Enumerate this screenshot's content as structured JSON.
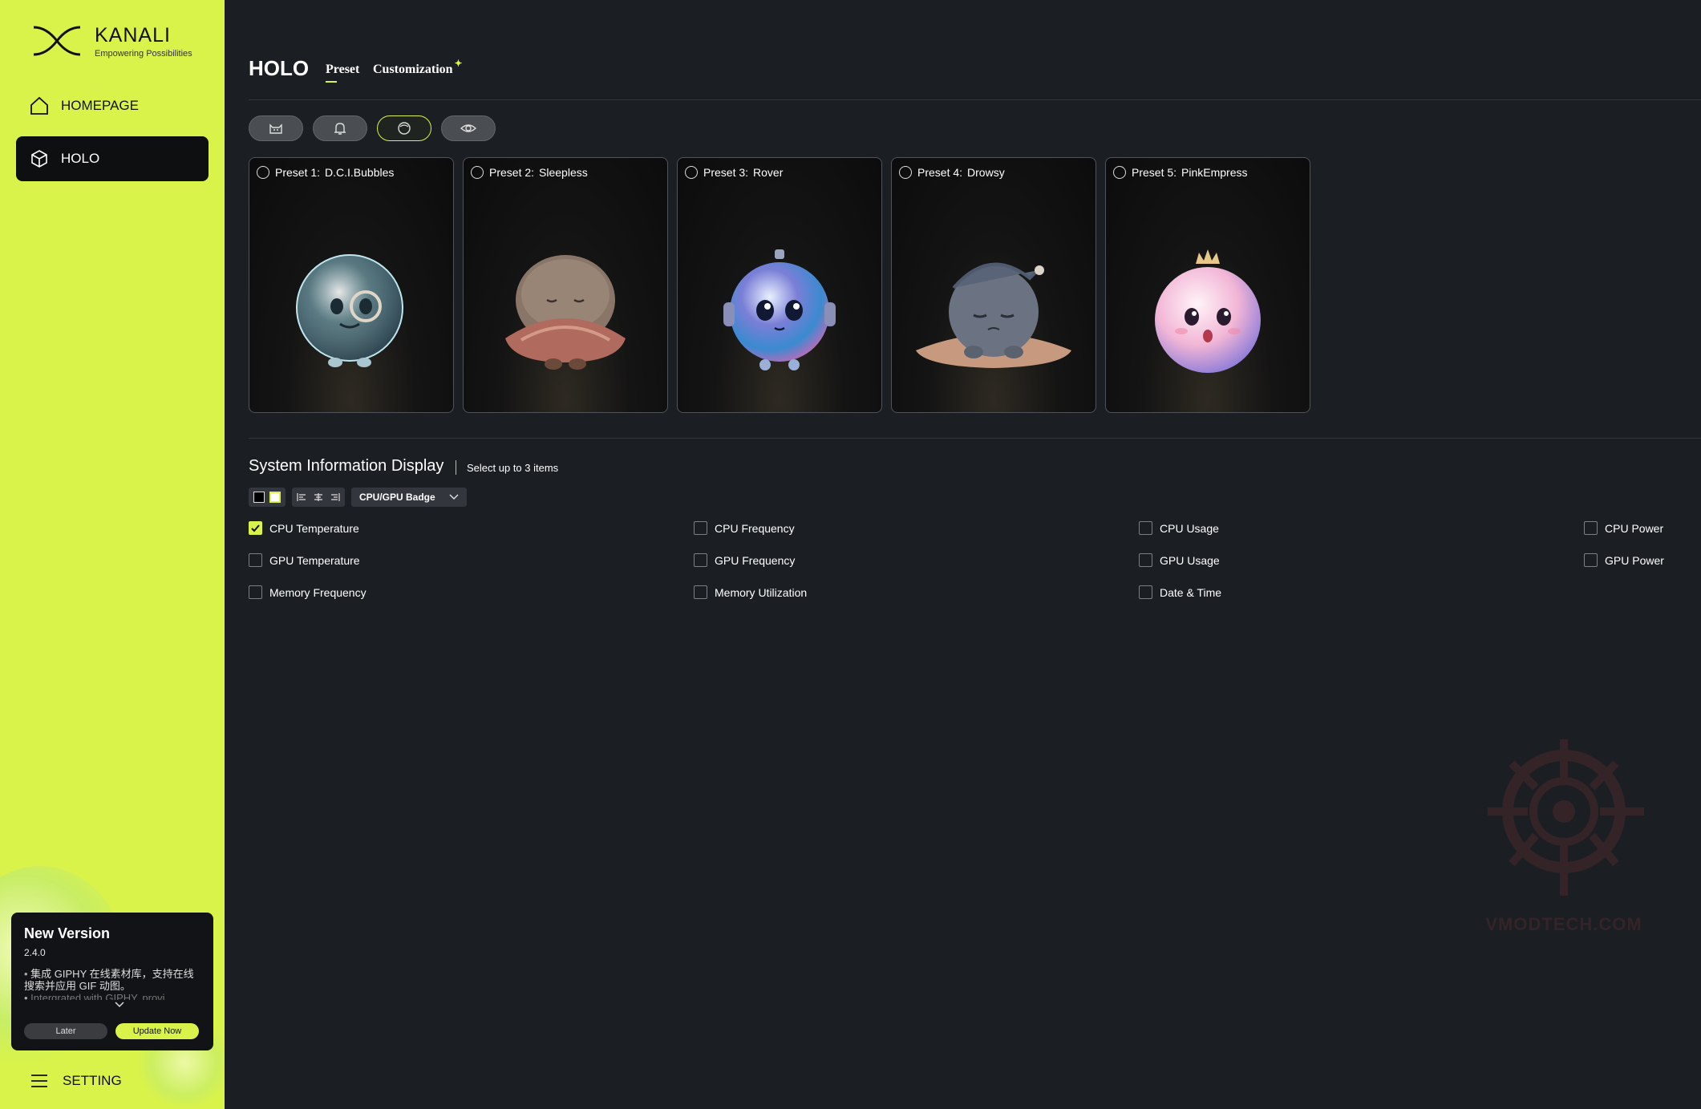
{
  "app": {
    "brand": "KANALI",
    "tagline": "Empowering Possibilities"
  },
  "sidebar": {
    "items": [
      {
        "label": "HOMEPAGE",
        "icon": "home-icon",
        "active": false
      },
      {
        "label": "HOLO",
        "icon": "cube-icon",
        "active": true
      }
    ],
    "setting_label": "SETTING"
  },
  "update": {
    "title": "New Version",
    "version": "2.4.0",
    "notes": [
      "集成 GIPHY 在线素材库，支持在线搜索并应用 GIF 动图。",
      "Intergrated with GIPHY, provi"
    ],
    "later_label": "Later",
    "update_label": "Update Now"
  },
  "main": {
    "title": "HOLO",
    "tabs": [
      {
        "label": "Preset",
        "active": true
      },
      {
        "label": "Customization",
        "badge": "✦"
      }
    ],
    "category_icons": [
      "cat-icon",
      "bell-icon",
      "orb-icon",
      "eye-icon"
    ],
    "active_category": 2,
    "presets": [
      {
        "id": "Preset 1:",
        "name": "D.C.I.Bubbles"
      },
      {
        "id": "Preset 2:",
        "name": "Sleepless"
      },
      {
        "id": "Preset 3:",
        "name": "Rover"
      },
      {
        "id": "Preset 4:",
        "name": "Drowsy"
      },
      {
        "id": "Preset 5:",
        "name": "PinkEmpress"
      }
    ],
    "system_info": {
      "title": "System Information Display",
      "hint": "Select up to 3 items",
      "style_select": "CPU/GPU Badge",
      "options": [
        {
          "label": "CPU Temperature",
          "checked": true
        },
        {
          "label": "CPU Frequency",
          "checked": false
        },
        {
          "label": "CPU Usage",
          "checked": false
        },
        {
          "label": "CPU Power",
          "checked": false
        },
        {
          "label": "GPU Temperature",
          "checked": false
        },
        {
          "label": "GPU Frequency",
          "checked": false
        },
        {
          "label": "GPU Usage",
          "checked": false
        },
        {
          "label": "GPU Power",
          "checked": false
        },
        {
          "label": "Memory Frequency",
          "checked": false
        },
        {
          "label": "Memory Utilization",
          "checked": false
        },
        {
          "label": "Date & Time",
          "checked": false
        }
      ]
    },
    "watermark": "VMODTECH.COM"
  },
  "colors": {
    "accent": "#d9f34a",
    "background": "#1b1e22",
    "sidebar_active": "#0e0f11"
  }
}
